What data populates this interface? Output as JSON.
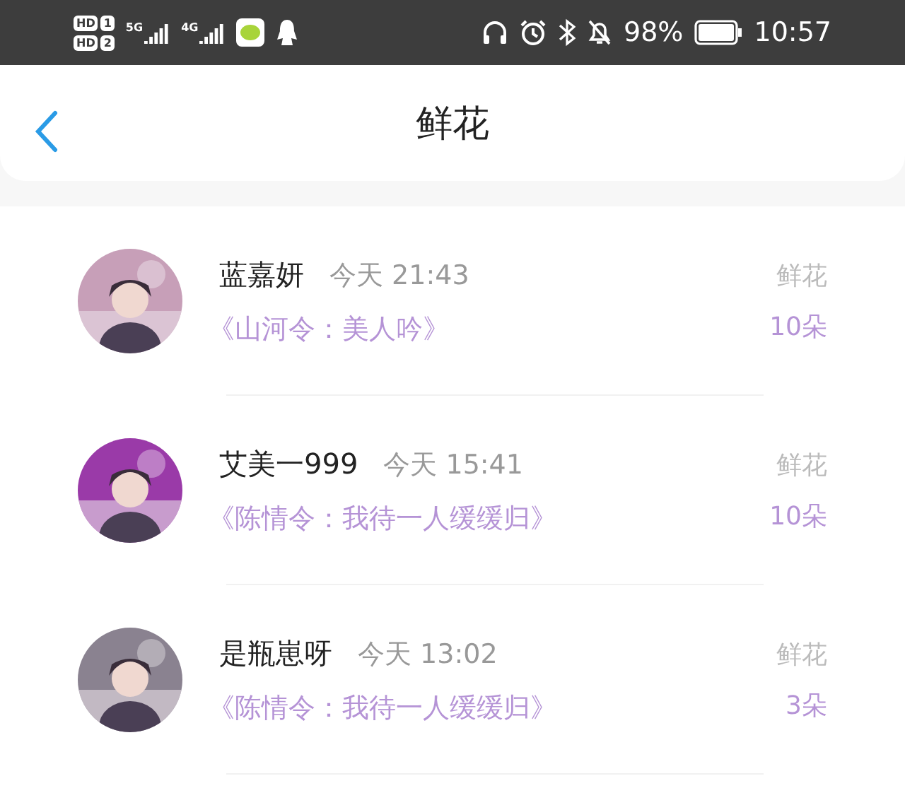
{
  "status_bar": {
    "sims": [
      {
        "badge": "HD",
        "slot": "1"
      },
      {
        "badge": "HD",
        "slot": "2"
      }
    ],
    "networks": [
      "5G",
      "4G"
    ],
    "battery_text": "98%",
    "time": "10:57"
  },
  "header": {
    "title": "鲜花"
  },
  "items": [
    {
      "name": "蓝嘉妍",
      "time": "今天 21:43",
      "work": "《山河令：美人吟》",
      "label": "鲜花",
      "count": "10朵"
    },
    {
      "name": "艾美一999",
      "time": "今天 15:41",
      "work": "《陈情令：我待一人缓缓归》",
      "label": "鲜花",
      "count": "10朵"
    },
    {
      "name": "是瓶崽呀",
      "time": "今天 13:02",
      "work": "《陈情令：我待一人缓缓归》",
      "label": "鲜花",
      "count": "3朵"
    }
  ]
}
